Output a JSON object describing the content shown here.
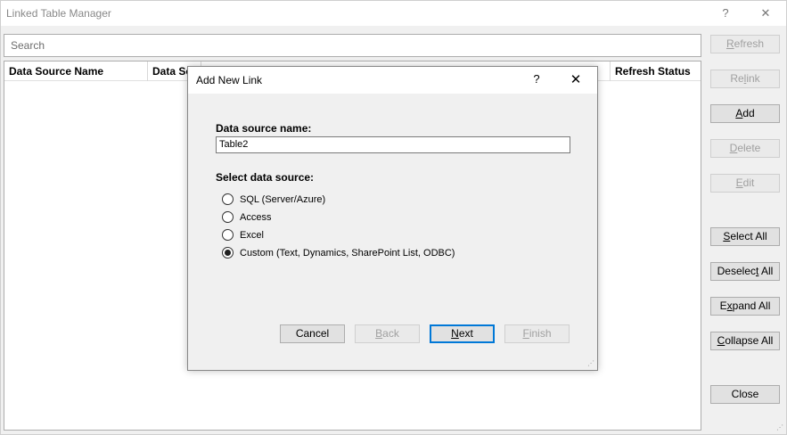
{
  "window": {
    "title": "Linked Table Manager",
    "help_glyph": "?",
    "close_glyph": "✕"
  },
  "search": {
    "placeholder": "Search"
  },
  "grid": {
    "columns": [
      "Data Source Name",
      "Data Sou",
      "Refresh Status"
    ]
  },
  "side_buttons": [
    {
      "pre": "",
      "u": "R",
      "post": "efresh",
      "enabled": false
    },
    {
      "pre": "Re",
      "u": "l",
      "post": "ink",
      "enabled": false
    },
    {
      "pre": "",
      "u": "A",
      "post": "dd",
      "enabled": true
    },
    {
      "pre": "",
      "u": "D",
      "post": "elete",
      "enabled": false
    },
    {
      "pre": "",
      "u": "E",
      "post": "dit",
      "enabled": false
    },
    {
      "pre": "",
      "u": "S",
      "post": "elect All",
      "enabled": true
    },
    {
      "pre": "Deselec",
      "u": "t",
      "post": " All",
      "enabled": true
    },
    {
      "pre": "E",
      "u": "x",
      "post": "pand All",
      "enabled": true
    },
    {
      "pre": "",
      "u": "C",
      "post": "ollapse All",
      "enabled": true
    },
    {
      "pre": "Close",
      "u": "",
      "post": "",
      "enabled": true
    }
  ],
  "dialog": {
    "title": "Add New Link",
    "help_glyph": "?",
    "close_glyph": "✕",
    "name_label": "Data source name:",
    "name_value": "Table2",
    "source_label": "Select data source:",
    "options": [
      {
        "label": "SQL (Server/Azure)",
        "checked": false
      },
      {
        "label": "Access",
        "checked": false
      },
      {
        "label": "Excel",
        "checked": false
      },
      {
        "label": "Custom (Text, Dynamics, SharePoint List, ODBC)",
        "checked": true
      }
    ],
    "buttons": {
      "cancel": "Cancel",
      "back_u": "B",
      "back_rest": "ack",
      "next_u": "N",
      "next_rest": "ext",
      "finish_u": "F",
      "finish_rest": "inish"
    }
  }
}
